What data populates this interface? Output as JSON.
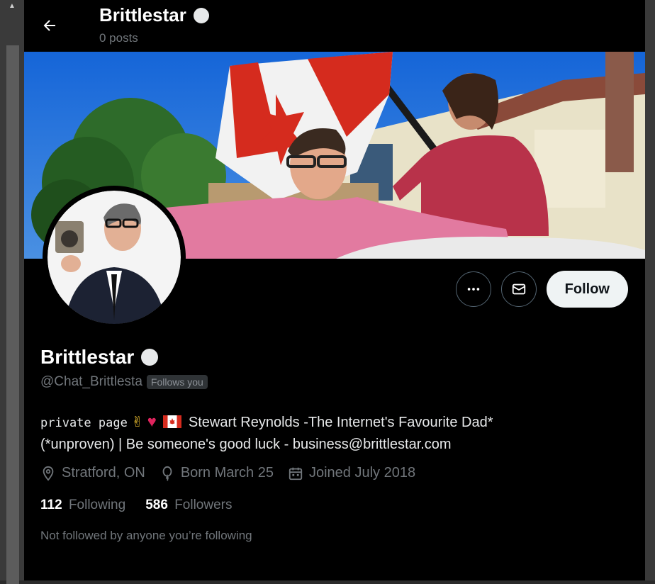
{
  "header": {
    "name": "Brittlestar",
    "posts": "0 posts"
  },
  "profile": {
    "name": "Brittlestar",
    "handle": "@Chat_Brittlesta",
    "follows_you": "Follows you",
    "bio": {
      "prefix_mono": "private page",
      "main": "Stewart Reynolds -The Internet's Favourite Dad*",
      "line2": "(*unproven) | Be someone's good luck - business@brittlestar.com"
    },
    "location": "Stratford, ON",
    "born": "Born March 25",
    "joined": "Joined July 2018",
    "following_count": "112",
    "following_label": "Following",
    "followers_count": "586",
    "followers_label": "Followers",
    "not_followed": "Not followed by anyone you’re following"
  },
  "actions": {
    "follow_label": "Follow",
    "more_icon": "more-icon",
    "message_icon": "mail-icon"
  },
  "colors": {
    "background": "#000000",
    "primary_text": "#e7e9ea",
    "secondary_text": "#71767b",
    "follow_bg": "#eff3f4",
    "border": "#536471"
  }
}
